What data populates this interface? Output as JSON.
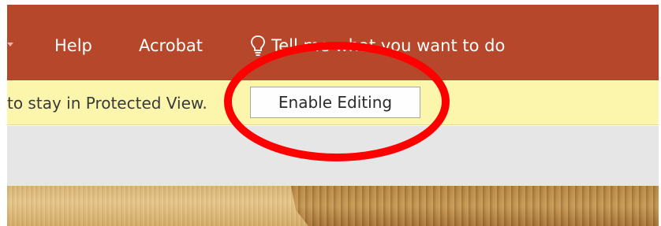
{
  "ribbon": {
    "tabs": [
      {
        "label": "Help"
      },
      {
        "label": "Acrobat"
      }
    ],
    "tell_me": {
      "icon": "lightbulb-icon",
      "text": "Tell me what you want to do"
    },
    "color": "#b7472a"
  },
  "message_bar": {
    "text": "to stay in Protected View.",
    "enable_editing_label": "Enable Editing",
    "color": "#fcf6ad"
  },
  "annotation": {
    "shape": "ellipse",
    "color": "#ff0000"
  }
}
